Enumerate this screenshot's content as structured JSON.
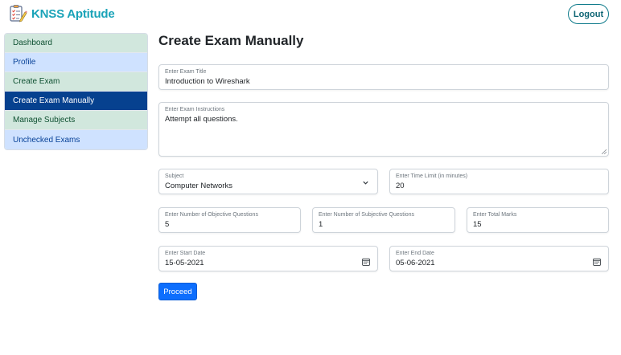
{
  "brand": {
    "name": "KNSS Aptitude",
    "accent": "#1aa3b8"
  },
  "header": {
    "logout_label": "Logout"
  },
  "sidebar": {
    "items": [
      {
        "label": "Dashboard"
      },
      {
        "label": "Profile"
      },
      {
        "label": "Create Exam"
      },
      {
        "label": "Create Exam Manually",
        "active": true
      },
      {
        "label": "Manage Subjects"
      },
      {
        "label": "Unchecked Exams"
      }
    ]
  },
  "main": {
    "title": "Create Exam Manually",
    "form": {
      "exam_title": {
        "label": "Enter Exam Title",
        "value": "Introduction to Wireshark"
      },
      "instructions": {
        "label": "Enter Exam Instructions",
        "value": "Attempt all questions."
      },
      "subject": {
        "label": "Subject",
        "value": "Computer Networks"
      },
      "time_limit": {
        "label": "Enter Time Limit (in minutes)",
        "value": "20"
      },
      "objective_questions": {
        "label": "Enter Number of Objective Questions",
        "value": "5"
      },
      "subjective_questions": {
        "label": "Enter Number of Subjective Questions",
        "value": "1"
      },
      "total_marks": {
        "label": "Enter Total Marks",
        "value": "15"
      },
      "start_date": {
        "label": "Enter Start Date",
        "value": "15-05-2021",
        "icon": "calendar-icon"
      },
      "end_date": {
        "label": "Enter End Date",
        "value": "05-06-2021",
        "icon": "calendar-icon"
      },
      "proceed_label": "Proceed"
    }
  },
  "colors": {
    "primary": "#0d6efd",
    "active_nav": "#06418f",
    "nav_green": "#d1e7dd",
    "nav_blue": "#cfe2ff"
  }
}
